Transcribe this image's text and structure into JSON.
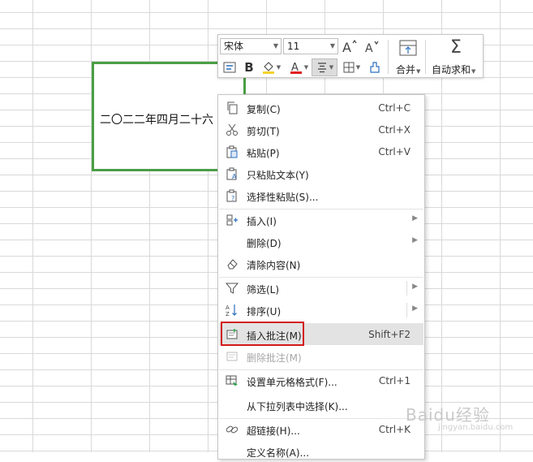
{
  "cell": {
    "text": "二〇二二年四月二十六"
  },
  "toolbar": {
    "font_name": "宋体",
    "font_size": "11",
    "merge_label": "合并",
    "autosum_label": "自动求和"
  },
  "menu": {
    "items": [
      {
        "label": "复制(C)",
        "shortcut": "Ctrl+C",
        "icon": "copy-icon"
      },
      {
        "label": "剪切(T)",
        "shortcut": "Ctrl+X",
        "icon": "scissors-icon"
      },
      {
        "label": "粘贴(P)",
        "shortcut": "Ctrl+V",
        "icon": "paste-icon"
      },
      {
        "label": "只粘贴文本(Y)",
        "shortcut": "",
        "icon": "paste-text-icon"
      },
      {
        "label": "选择性粘贴(S)...",
        "shortcut": "",
        "icon": "paste-special-icon"
      },
      {
        "label": "插入(I)",
        "shortcut": "",
        "icon": "insert-cells-icon",
        "submenu": true
      },
      {
        "label": "删除(D)",
        "shortcut": "",
        "icon": "",
        "submenu": true
      },
      {
        "label": "清除内容(N)",
        "shortcut": "",
        "icon": "eraser-icon"
      },
      {
        "label": "筛选(L)",
        "shortcut": "",
        "icon": "filter-icon",
        "submenu": true
      },
      {
        "label": "排序(U)",
        "shortcut": "",
        "icon": "sort-az-icon",
        "submenu": true
      },
      {
        "label": "插入批注(M)",
        "shortcut": "Shift+F2",
        "icon": "insert-comment-icon",
        "highlighted": true
      },
      {
        "label": "删除批注(M)",
        "shortcut": "",
        "icon": "delete-comment-icon",
        "disabled": true
      },
      {
        "label": "设置单元格格式(F)...",
        "shortcut": "Ctrl+1",
        "icon": "format-cells-icon"
      },
      {
        "label": "从下拉列表中选择(K)...",
        "shortcut": "",
        "icon": ""
      },
      {
        "label": "超链接(H)...",
        "shortcut": "Ctrl+K",
        "icon": "hyperlink-icon"
      },
      {
        "label": "定义名称(A)...",
        "shortcut": "",
        "icon": ""
      }
    ]
  },
  "watermark": {
    "text": "Baidu经验",
    "sub": "jingyan.baidu.com"
  },
  "colors": {
    "selection_border": "#4a9e46",
    "highlight_box": "#d41a1a",
    "font_color_bar": "#e0201b",
    "fill_color_bar": "#f3d22b"
  }
}
